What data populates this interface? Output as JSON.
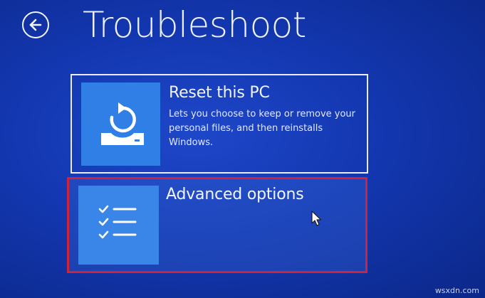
{
  "header": {
    "title": "Troubleshoot",
    "back_icon": "back-arrow-circle-icon"
  },
  "options": [
    {
      "title": "Reset this PC",
      "description": "Lets you choose to keep or remove your personal files, and then reinstalls Windows.",
      "icon": "reset-pc-icon"
    },
    {
      "title": "Advanced options",
      "description": "",
      "icon": "checklist-icon",
      "highlighted": true,
      "highlight_color": "#d0233b"
    }
  ],
  "watermark": "wsxdn.com",
  "colors": {
    "background": "#1337b0",
    "tile": "#2f7fe6",
    "highlight": "#d0233b"
  }
}
